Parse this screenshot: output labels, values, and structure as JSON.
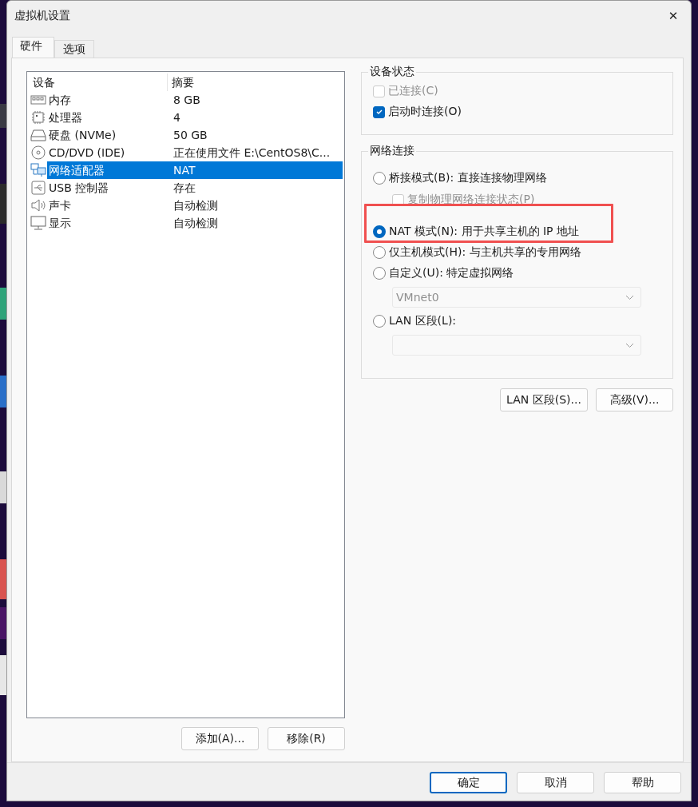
{
  "window": {
    "title": "虚拟机设置",
    "close": "✕"
  },
  "tabs": [
    {
      "label": "硬件",
      "selected": true
    },
    {
      "label": "选项",
      "selected": false
    }
  ],
  "devices": {
    "columns": [
      "设备",
      "摘要"
    ],
    "rows": [
      {
        "kind": "memory",
        "name": "内存",
        "summary": "8 GB",
        "selected": false
      },
      {
        "kind": "cpu",
        "name": "处理器",
        "summary": "4",
        "selected": false
      },
      {
        "kind": "disk",
        "name": "硬盘 (NVMe)",
        "summary": "50 GB",
        "selected": false
      },
      {
        "kind": "cdrom",
        "name": "CD/DVD (IDE)",
        "summary": "正在使用文件 E:\\CentOS8\\C...",
        "selected": false
      },
      {
        "kind": "network",
        "name": "网络适配器",
        "summary": "NAT",
        "selected": true
      },
      {
        "kind": "usb",
        "name": "USB 控制器",
        "summary": "存在",
        "selected": false
      },
      {
        "kind": "sound",
        "name": "声卡",
        "summary": "自动检测",
        "selected": false
      },
      {
        "kind": "display",
        "name": "显示",
        "summary": "自动检测",
        "selected": false
      }
    ]
  },
  "device_buttons": [
    "添加(A)...",
    "移除(R)"
  ],
  "device_status": {
    "title": "设备状态",
    "options": [
      {
        "label": "已连接(C)",
        "checked": false,
        "disabled": true
      },
      {
        "label": "启动时连接(O)",
        "checked": true,
        "disabled": false
      }
    ]
  },
  "network": {
    "title": "网络连接",
    "options": [
      {
        "kind": "radio",
        "label": "桥接模式(B): 直接连接物理网络",
        "selected": false
      },
      {
        "kind": "checkbox",
        "label": "复制物理网络连接状态(P)",
        "checked": false,
        "disabled": true
      },
      {
        "kind": "radio",
        "label": "NAT 模式(N): 用于共享主机的 IP 地址",
        "selected": true
      },
      {
        "kind": "radio",
        "label": "仅主机模式(H): 与主机共享的专用网络",
        "selected": false
      },
      {
        "kind": "radio",
        "label": "自定义(U): 特定虚拟网络",
        "selected": false
      },
      {
        "kind": "select",
        "value": "VMnet0",
        "disabled": true
      },
      {
        "kind": "radio",
        "label": "LAN 区段(L):",
        "selected": false
      },
      {
        "kind": "select",
        "disabled": true
      }
    ]
  },
  "network_buttons": [
    "LAN 区段(S)...",
    "高级(V)..."
  ],
  "footer_buttons": [
    {
      "label": "确定",
      "default": true
    },
    {
      "label": "取消",
      "default": false
    },
    {
      "label": "帮助",
      "default": false
    }
  ]
}
